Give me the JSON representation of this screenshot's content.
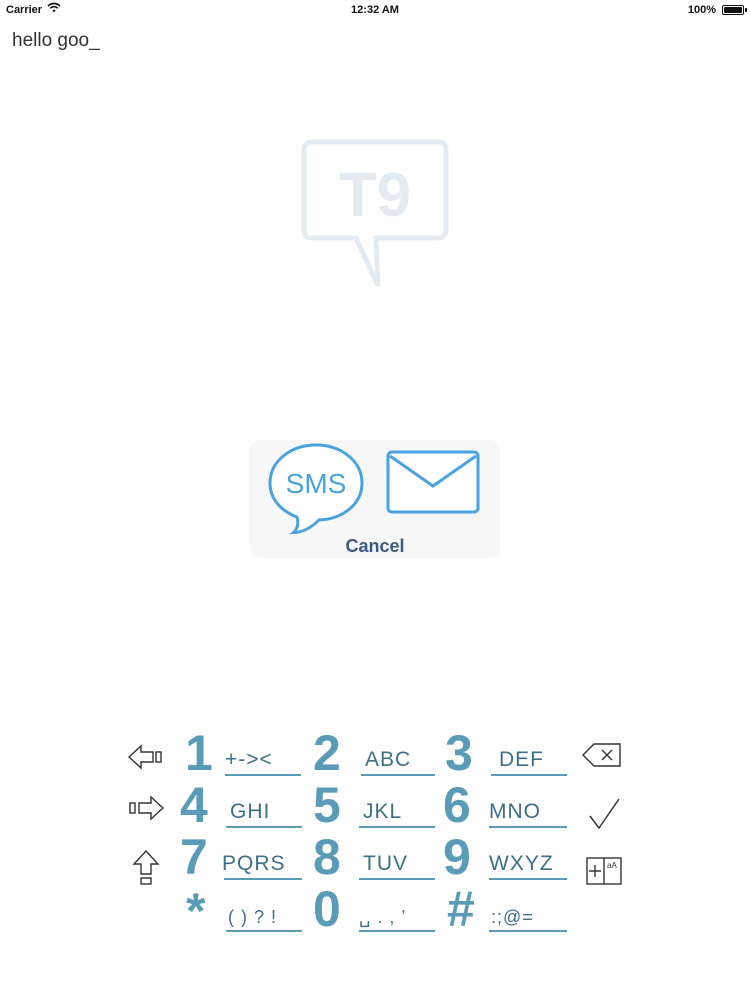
{
  "status_bar": {
    "carrier": "Carrier",
    "time": "12:32 AM",
    "battery": "100%"
  },
  "text_field": {
    "value": "hello goo_"
  },
  "logo": {
    "text": "T9"
  },
  "share_sheet": {
    "sms_label": "SMS",
    "cancel_label": "Cancel"
  },
  "keypad": {
    "keys": [
      {
        "digit": "1",
        "letters": "+-><"
      },
      {
        "digit": "2",
        "letters": "ABC"
      },
      {
        "digit": "3",
        "letters": "DEF"
      },
      {
        "digit": "4",
        "letters": "GHI"
      },
      {
        "digit": "5",
        "letters": "JKL"
      },
      {
        "digit": "6",
        "letters": "MNO"
      },
      {
        "digit": "7",
        "letters": "PQRS"
      },
      {
        "digit": "8",
        "letters": "TUV"
      },
      {
        "digit": "9",
        "letters": "WXYZ"
      },
      {
        "digit": "*",
        "letters": "( ) ? !"
      },
      {
        "digit": "0",
        "letters": "␣ . , ’"
      },
      {
        "digit": "#",
        "letters": ":;@="
      }
    ],
    "side_icons": [
      "cursor-left-icon",
      "cursor-right-icon",
      "shift-icon",
      "backspace-icon",
      "checkmark-icon",
      "add-word-icon"
    ]
  },
  "colors": {
    "accent": "#5a9bb8",
    "icon_blue": "#4aa3df",
    "cancel": "#3d5a84"
  }
}
